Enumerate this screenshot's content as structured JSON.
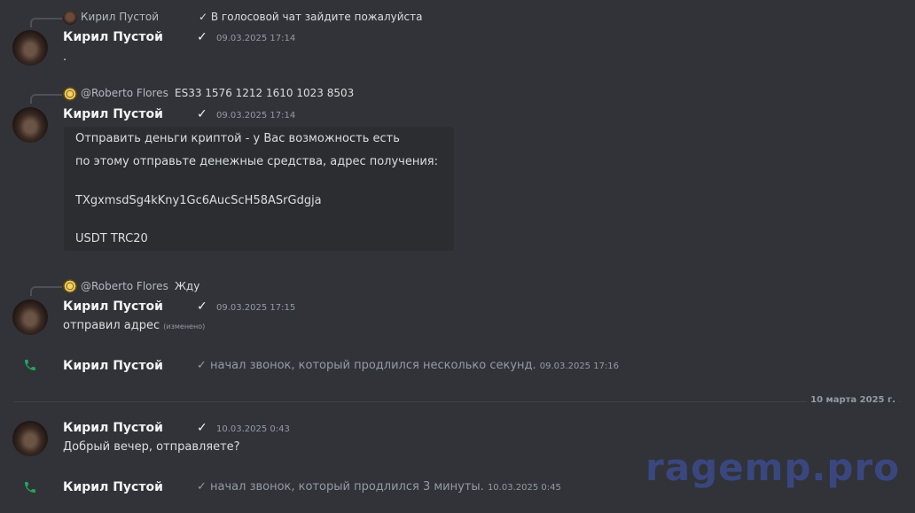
{
  "messages": {
    "m1": {
      "reply_author": "Кирил Пустой",
      "reply_text": "✓ В голосовой чат зайдите пожалуйста",
      "author": "Кирил Пустой",
      "check": "✓",
      "timestamp": "09.03.2025 17:14",
      "content": "."
    },
    "m2": {
      "reply_author": "@Roberto Flores",
      "reply_text": "ES33 1576 1212 1610 1023 8503",
      "author": "Кирил Пустой",
      "check": "✓",
      "timestamp": "09.03.2025 17:14",
      "embed_lines": [
        "Отправить деньги криптой - у Вас возможность есть",
        "по этому отправьте денежные средства, адрес получения:",
        "TXgxmsdSg4kKny1Gc6AucScH58ASrGdgja",
        "USDT TRC20"
      ]
    },
    "m3": {
      "reply_author": "@Roberto Flores",
      "reply_text": "Жду",
      "author": "Кирил Пустой",
      "check": "✓",
      "timestamp": "09.03.2025 17:15",
      "content": "отправил адрес",
      "edited": "(изменено)"
    },
    "call1": {
      "author": "Кирил Пустой",
      "text": "✓ начал звонок, который продлился несколько секунд.",
      "timestamp": "09.03.2025 17:16"
    },
    "date_divider": "10 марта 2025 г.",
    "m4": {
      "author": "Кирил Пустой",
      "check": "✓",
      "timestamp": "10.03.2025 0:43",
      "content": "Добрый вечер, отправляете?"
    },
    "call2": {
      "author": "Кирил Пустой",
      "text": "✓ начал звонок, который продлился 3 минуты.",
      "timestamp": "10.03.2025 0:45"
    }
  },
  "icons": {
    "call": "phone-icon",
    "reply_spine": "reply-spine"
  },
  "colors": {
    "background": "#313338",
    "embed": "#2b2d31",
    "call_green": "#23a55a",
    "watermark": "#3b4a87"
  },
  "watermark": "ragemp.pro"
}
